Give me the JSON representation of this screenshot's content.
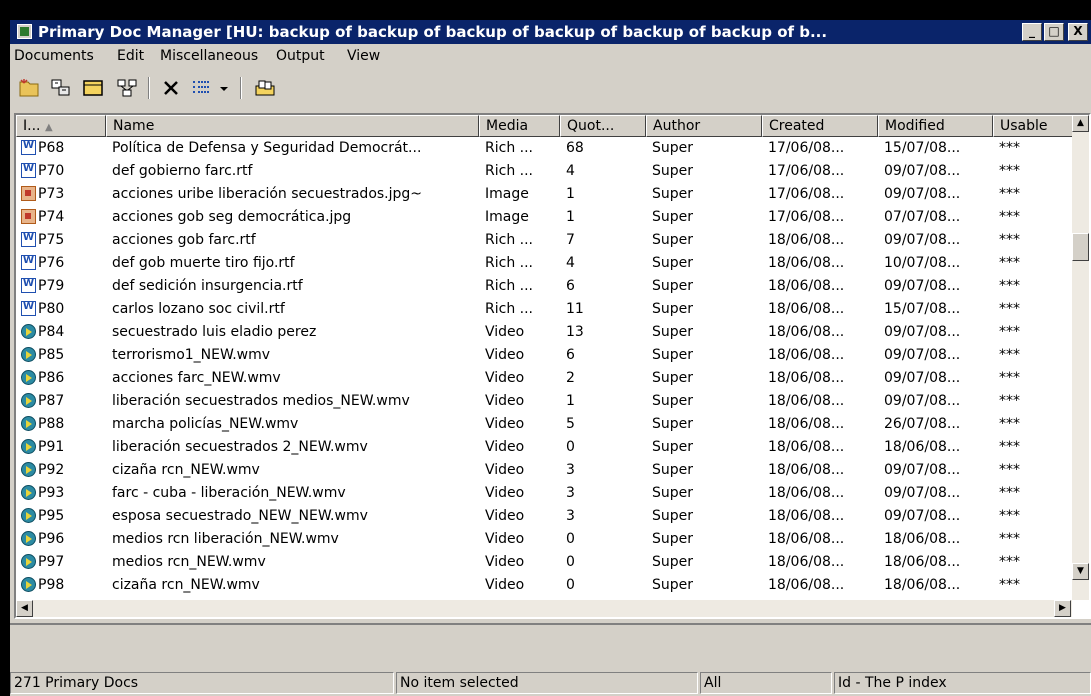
{
  "window": {
    "title": "Primary Doc Manager [HU: backup of backup of backup of backup of backup of backup of b...",
    "controls": {
      "minimize": "_",
      "maximize": "□",
      "close": "X"
    }
  },
  "menu": [
    "Documents",
    "Edit",
    "Miscellaneous",
    "Output",
    "View"
  ],
  "toolbar": {
    "icons": [
      "new-doc-icon",
      "assign-doc-icon",
      "card-icon",
      "network-icon",
      "delete-icon",
      "view-options-icon",
      "dropdown-arrow-icon",
      "family-icon"
    ]
  },
  "columns": [
    "I...",
    "Name",
    "Media",
    "Quot...",
    "Author",
    "Created",
    "Modified",
    "Usable"
  ],
  "rows": [
    {
      "icon": "rtf",
      "id": "P68",
      "name": "Política de Defensa y Seguridad Democrát...",
      "media": "Rich ...",
      "quot": "68",
      "author": "Super",
      "created": "17/06/08...",
      "modified": "15/07/08...",
      "usable": "***"
    },
    {
      "icon": "rtf",
      "id": "P70",
      "name": "def gobierno farc.rtf",
      "media": "Rich ...",
      "quot": "4",
      "author": "Super",
      "created": "17/06/08...",
      "modified": "09/07/08...",
      "usable": "***"
    },
    {
      "icon": "img",
      "id": "P73",
      "name": "acciones uribe liberación secuestrados.jpg~",
      "media": "Image",
      "quot": "1",
      "author": "Super",
      "created": "17/06/08...",
      "modified": "09/07/08...",
      "usable": "***"
    },
    {
      "icon": "img",
      "id": "P74",
      "name": "acciones gob seg democrática.jpg",
      "media": "Image",
      "quot": "1",
      "author": "Super",
      "created": "17/06/08...",
      "modified": "07/07/08...",
      "usable": "***"
    },
    {
      "icon": "rtf",
      "id": "P75",
      "name": "acciones gob farc.rtf",
      "media": "Rich ...",
      "quot": "7",
      "author": "Super",
      "created": "18/06/08...",
      "modified": "09/07/08...",
      "usable": "***"
    },
    {
      "icon": "rtf",
      "id": "P76",
      "name": "def gob muerte tiro fijo.rtf",
      "media": "Rich ...",
      "quot": "4",
      "author": "Super",
      "created": "18/06/08...",
      "modified": "10/07/08...",
      "usable": "***"
    },
    {
      "icon": "rtf",
      "id": "P79",
      "name": "def sedición insurgencia.rtf",
      "media": "Rich ...",
      "quot": "6",
      "author": "Super",
      "created": "18/06/08...",
      "modified": "09/07/08...",
      "usable": "***"
    },
    {
      "icon": "rtf",
      "id": "P80",
      "name": "carlos lozano soc civil.rtf",
      "media": "Rich ...",
      "quot": "11",
      "author": "Super",
      "created": "18/06/08...",
      "modified": "15/07/08...",
      "usable": "***"
    },
    {
      "icon": "vid",
      "id": "P84",
      "name": "secuestrado luis eladio perez",
      "media": "Video",
      "quot": "13",
      "author": "Super",
      "created": "18/06/08...",
      "modified": "09/07/08...",
      "usable": "***"
    },
    {
      "icon": "vid",
      "id": "P85",
      "name": "terrorismo1_NEW.wmv",
      "media": "Video",
      "quot": "6",
      "author": "Super",
      "created": "18/06/08...",
      "modified": "09/07/08...",
      "usable": "***"
    },
    {
      "icon": "vid",
      "id": "P86",
      "name": "acciones farc_NEW.wmv",
      "media": "Video",
      "quot": "2",
      "author": "Super",
      "created": "18/06/08...",
      "modified": "09/07/08...",
      "usable": "***"
    },
    {
      "icon": "vid",
      "id": "P87",
      "name": "liberación secuestrados medios_NEW.wmv",
      "media": "Video",
      "quot": "1",
      "author": "Super",
      "created": "18/06/08...",
      "modified": "09/07/08...",
      "usable": "***"
    },
    {
      "icon": "vid",
      "id": "P88",
      "name": "marcha policías_NEW.wmv",
      "media": "Video",
      "quot": "5",
      "author": "Super",
      "created": "18/06/08...",
      "modified": "26/07/08...",
      "usable": "***"
    },
    {
      "icon": "vid",
      "id": "P91",
      "name": "liberación secuestrados 2_NEW.wmv",
      "media": "Video",
      "quot": "0",
      "author": "Super",
      "created": "18/06/08...",
      "modified": "18/06/08...",
      "usable": "***"
    },
    {
      "icon": "vid",
      "id": "P92",
      "name": "cizaña rcn_NEW.wmv",
      "media": "Video",
      "quot": "3",
      "author": "Super",
      "created": "18/06/08...",
      "modified": "09/07/08...",
      "usable": "***"
    },
    {
      "icon": "vid",
      "id": "P93",
      "name": "farc - cuba - liberación_NEW.wmv",
      "media": "Video",
      "quot": "3",
      "author": "Super",
      "created": "18/06/08...",
      "modified": "09/07/08...",
      "usable": "***"
    },
    {
      "icon": "vid",
      "id": "P95",
      "name": "esposa secuestrado_NEW_NEW.wmv",
      "media": "Video",
      "quot": "3",
      "author": "Super",
      "created": "18/06/08...",
      "modified": "09/07/08...",
      "usable": "***"
    },
    {
      "icon": "vid",
      "id": "P96",
      "name": "medios rcn liberación_NEW.wmv",
      "media": "Video",
      "quot": "0",
      "author": "Super",
      "created": "18/06/08...",
      "modified": "18/06/08...",
      "usable": "***"
    },
    {
      "icon": "vid",
      "id": "P97",
      "name": "medios rcn_NEW.wmv",
      "media": "Video",
      "quot": "0",
      "author": "Super",
      "created": "18/06/08...",
      "modified": "18/06/08...",
      "usable": "***"
    },
    {
      "icon": "vid",
      "id": "P98",
      "name": "cizaña rcn_NEW.wmv",
      "media": "Video",
      "quot": "0",
      "author": "Super",
      "created": "18/06/08...",
      "modified": "18/06/08...",
      "usable": "***"
    }
  ],
  "status": {
    "count": "271 Primary Docs",
    "selection": "No item selected",
    "filter": "All",
    "sort": "Id - The P index"
  },
  "colors": {
    "titlebar": "#0a246a",
    "face": "#d4d0c8"
  }
}
